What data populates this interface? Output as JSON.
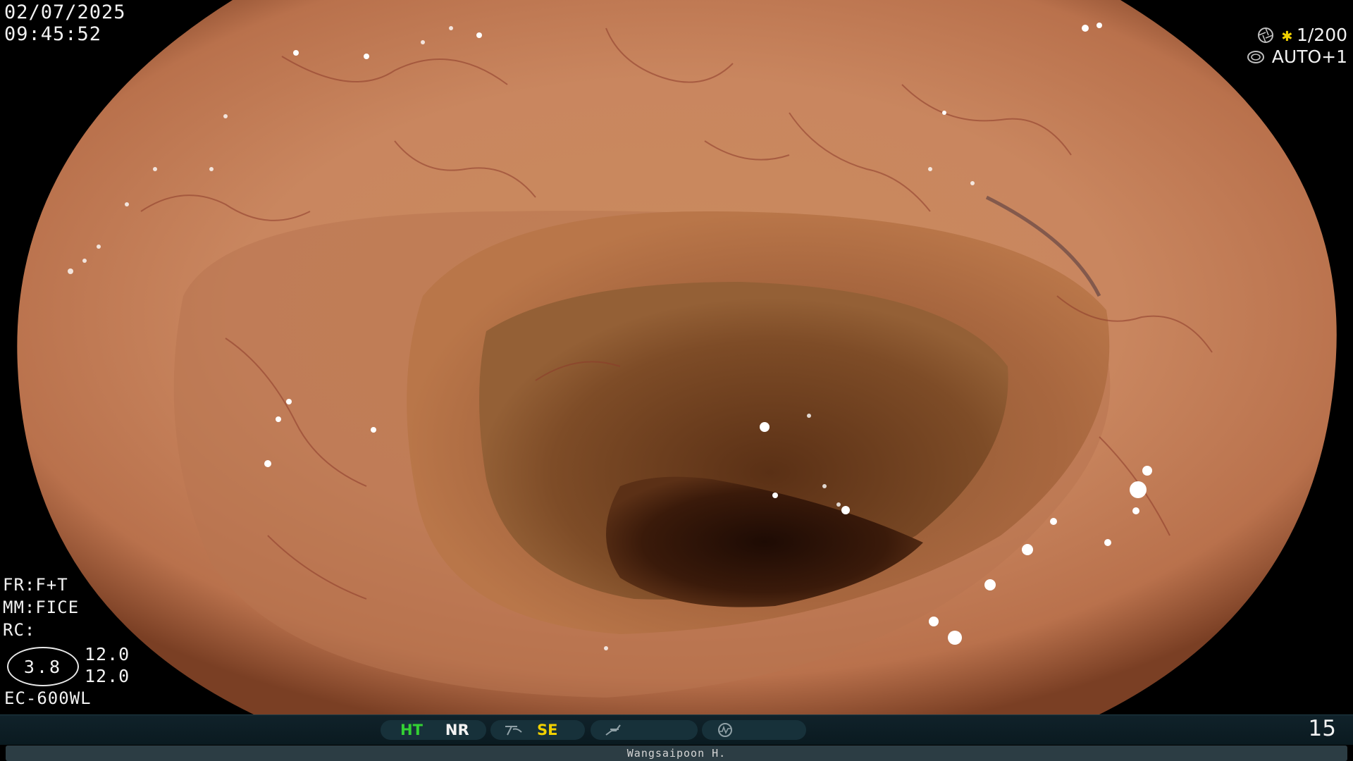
{
  "header": {
    "date": "02/07/2025",
    "time": "09:45:52"
  },
  "exposure": {
    "shutter": "1/200",
    "iris": "AUTO+1",
    "shutter_icon": "aperture-icon",
    "iris_icon": "iris-icon",
    "star_color": "#f0d000"
  },
  "settings": {
    "fr": "FR:F+T",
    "mm": "MM:FICE",
    "rc": "RC:",
    "ratio": "3.8",
    "value_a": "12.0",
    "value_b": "12.0",
    "scope_model": "EC-600WL"
  },
  "status_bar": {
    "ht_label": "HT",
    "nr_label": "NR",
    "se_label": "SE",
    "ht_color": "#33d133",
    "se_color": "#f0d000",
    "icons": [
      "structure-enhance-icon",
      "curve-icon",
      "waveform-icon"
    ],
    "frame_number": "15"
  },
  "footer": {
    "operator": "Wangsaipoon H."
  }
}
